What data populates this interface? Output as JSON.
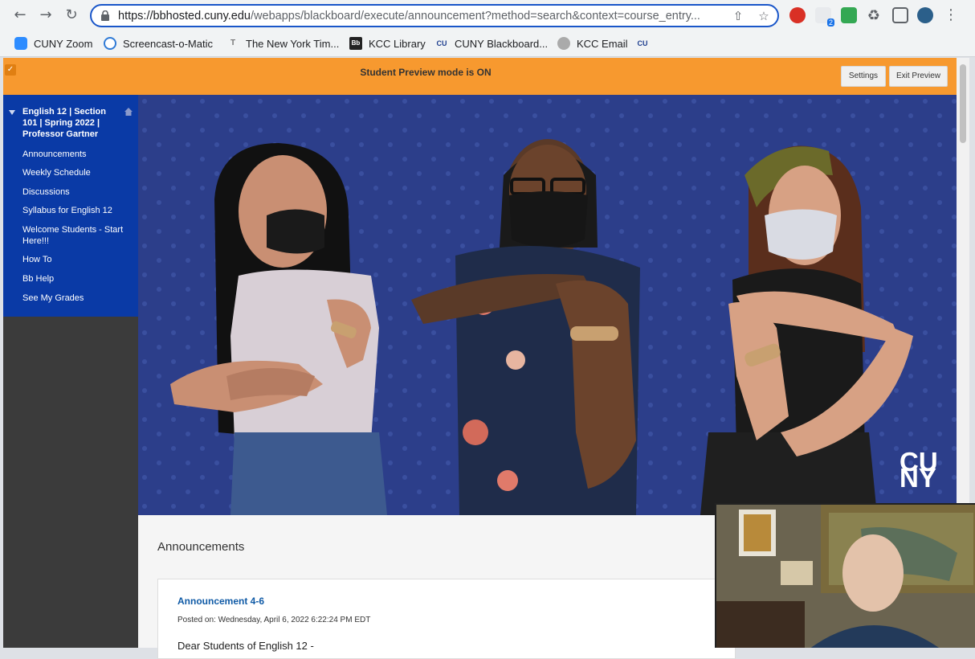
{
  "browser": {
    "url_host": "https://bbhosted.cuny.edu",
    "url_path": "/webapps/blackboard/execute/announcement?method=search&context=course_entry...",
    "bookmarks": [
      {
        "label": "CUNY Zoom",
        "icon": "zoom-icon",
        "color": "#2d8cff"
      },
      {
        "label": "Screencast-o-Matic",
        "icon": "screencast-icon",
        "color": "#2f7ad6"
      },
      {
        "label": "The New York Tim...",
        "icon": "nyt-icon",
        "color": "#777777"
      },
      {
        "label": "KCC Library",
        "icon": "bb-icon",
        "color": "#222222"
      },
      {
        "label": "CUNY Blackboard...",
        "icon": "cuny-icon",
        "color": "#1f3f8f"
      },
      {
        "label": "KCC Email",
        "icon": "globe-icon",
        "color": "#888888"
      },
      {
        "label": "",
        "icon": "cuny-icon",
        "color": "#1f3f8f"
      }
    ],
    "extension_badge": "2"
  },
  "preview": {
    "message": "Student Preview mode is ON",
    "settings_label": "Settings",
    "exit_label": "Exit Preview"
  },
  "course": {
    "title": "English 12 | Section 101 | Spring 2022 | Professor Gartner",
    "menu": [
      "Announcements",
      "Weekly Schedule",
      "Discussions",
      "Syllabus for English 12",
      "Welcome Students - Start Here!!!",
      "How To",
      "Bb Help",
      "See My Grades"
    ]
  },
  "banner": {
    "logo_top": "CU",
    "logo_bottom": "NY"
  },
  "main": {
    "heading": "Announcements",
    "announcement": {
      "title": "Announcement 4-6",
      "posted": "Posted on: Wednesday, April 6, 2022 6:22:24 PM EDT",
      "body": "Dear Students of English 12 -"
    }
  },
  "colors": {
    "preview_bar": "#f7992f",
    "course_menu": "#0a3aa6",
    "banner_bg": "#2c3e8a",
    "link_blue": "#0f5aa6"
  }
}
